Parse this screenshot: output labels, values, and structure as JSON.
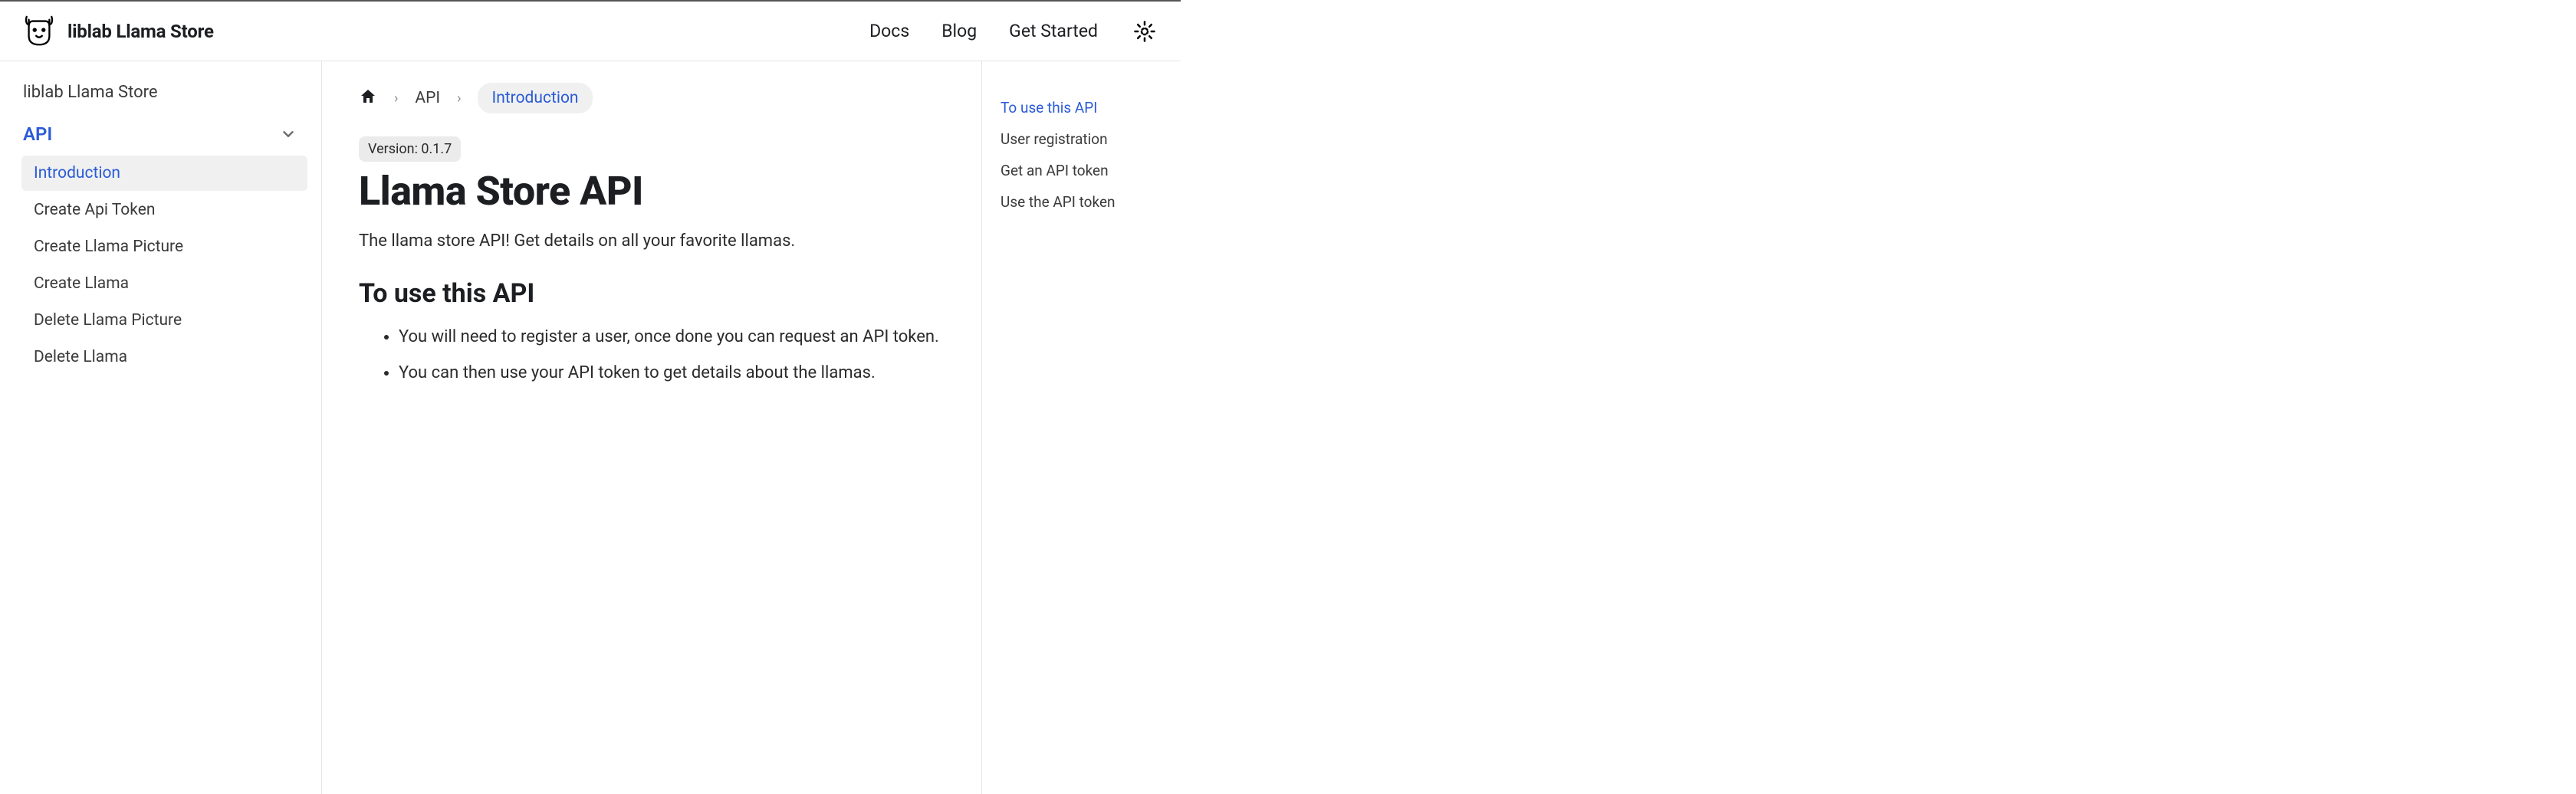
{
  "brand": {
    "title": "liblab Llama Store"
  },
  "topnav": {
    "docs": "Docs",
    "blog": "Blog",
    "get_started": "Get Started"
  },
  "sidebar": {
    "title": "liblab Llama Store",
    "section": "API",
    "items": [
      "Introduction",
      "Create Api Token",
      "Create Llama Picture",
      "Create Llama",
      "Delete Llama Picture",
      "Delete Llama"
    ]
  },
  "breadcrumb": {
    "api": "API",
    "current": "Introduction"
  },
  "page": {
    "version": "Version: 0.1.7",
    "title": "Llama Store API",
    "lead": "The llama store API! Get details on all your favorite llamas.",
    "section_heading": "To use this API",
    "bullets": [
      "You will need to register a user, once done you can request an API token.",
      "You can then use your API token to get details about the llamas."
    ]
  },
  "toc": {
    "items": [
      "To use this API",
      "User registration",
      "Get an API token",
      "Use the API token"
    ]
  }
}
